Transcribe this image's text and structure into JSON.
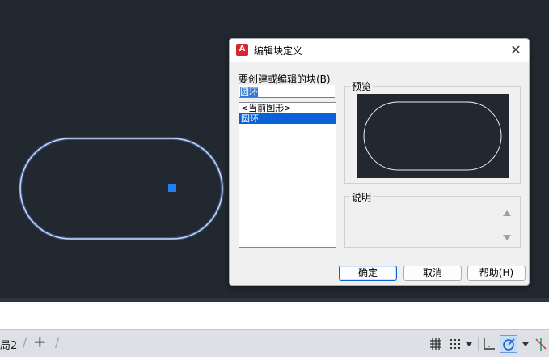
{
  "dialog": {
    "title": "编辑块定义",
    "app_icon_text": "A",
    "block_label": "要创建或编辑的块(B)",
    "block_name_value": "圆环",
    "block_list": [
      "<当前图形>",
      "圆环"
    ],
    "selected_index": 1,
    "preview_label": "预览",
    "description_label": "说明",
    "description_value": "",
    "ok_label": "确定",
    "cancel_label": "取消",
    "help_label": "帮助(H)"
  },
  "statusbar": {
    "layout_tab": "局2"
  },
  "colors": {
    "canvas_bg": "#212830",
    "shape_stroke": "#a9c4ff",
    "grip": "#1e7ef2",
    "selection": "#0b62d6"
  },
  "icons": [
    "close-icon",
    "add-layout-icon",
    "grid-icon",
    "snap-icon",
    "chevron-down-icon",
    "ortho-icon",
    "polar-tracking-icon",
    "object-snap-tracking-icon"
  ]
}
